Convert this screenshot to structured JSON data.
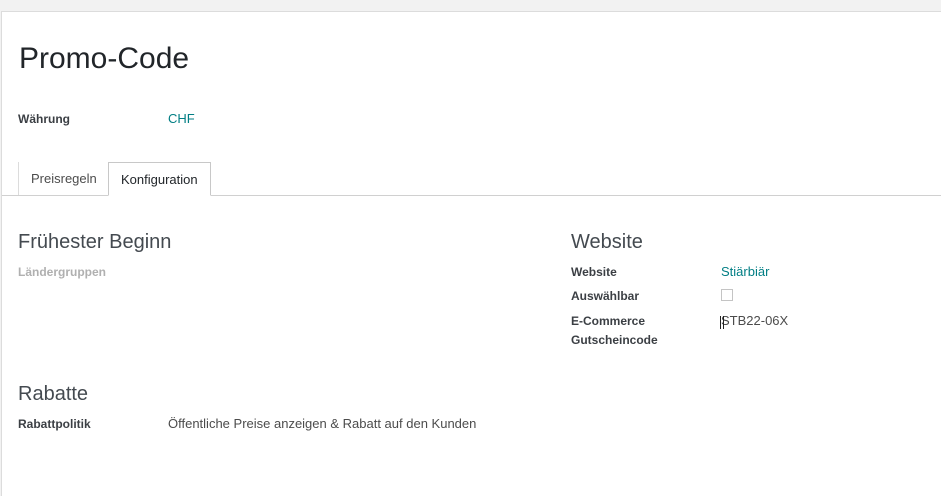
{
  "form": {
    "title": "Promo-Code",
    "currency_label": "Währung",
    "currency_value": "CHF"
  },
  "tabs": [
    {
      "label": "Preisregeln",
      "active": false
    },
    {
      "label": "Konfiguration",
      "active": true
    }
  ],
  "availability": {
    "heading": "Frühester Beginn",
    "country_groups_label": "Ländergruppen"
  },
  "website_section": {
    "heading": "Website",
    "website_label": "Website",
    "website_value": "Stiärbiär",
    "selectable_label": "Auswählbar",
    "selectable_checked": false,
    "ecommerce_label_line1": "E-Commerce",
    "ecommerce_label_line2": "Gutscheincode",
    "ecommerce_value": "STB22-06X"
  },
  "discounts": {
    "heading": "Rabatte",
    "policy_label": "Rabattpolitik",
    "policy_value": "Öffentliche Preise anzeigen & Rabatt auf den Kunden"
  },
  "colors": {
    "link": "#017e84",
    "muted": "#b0b0b0"
  }
}
